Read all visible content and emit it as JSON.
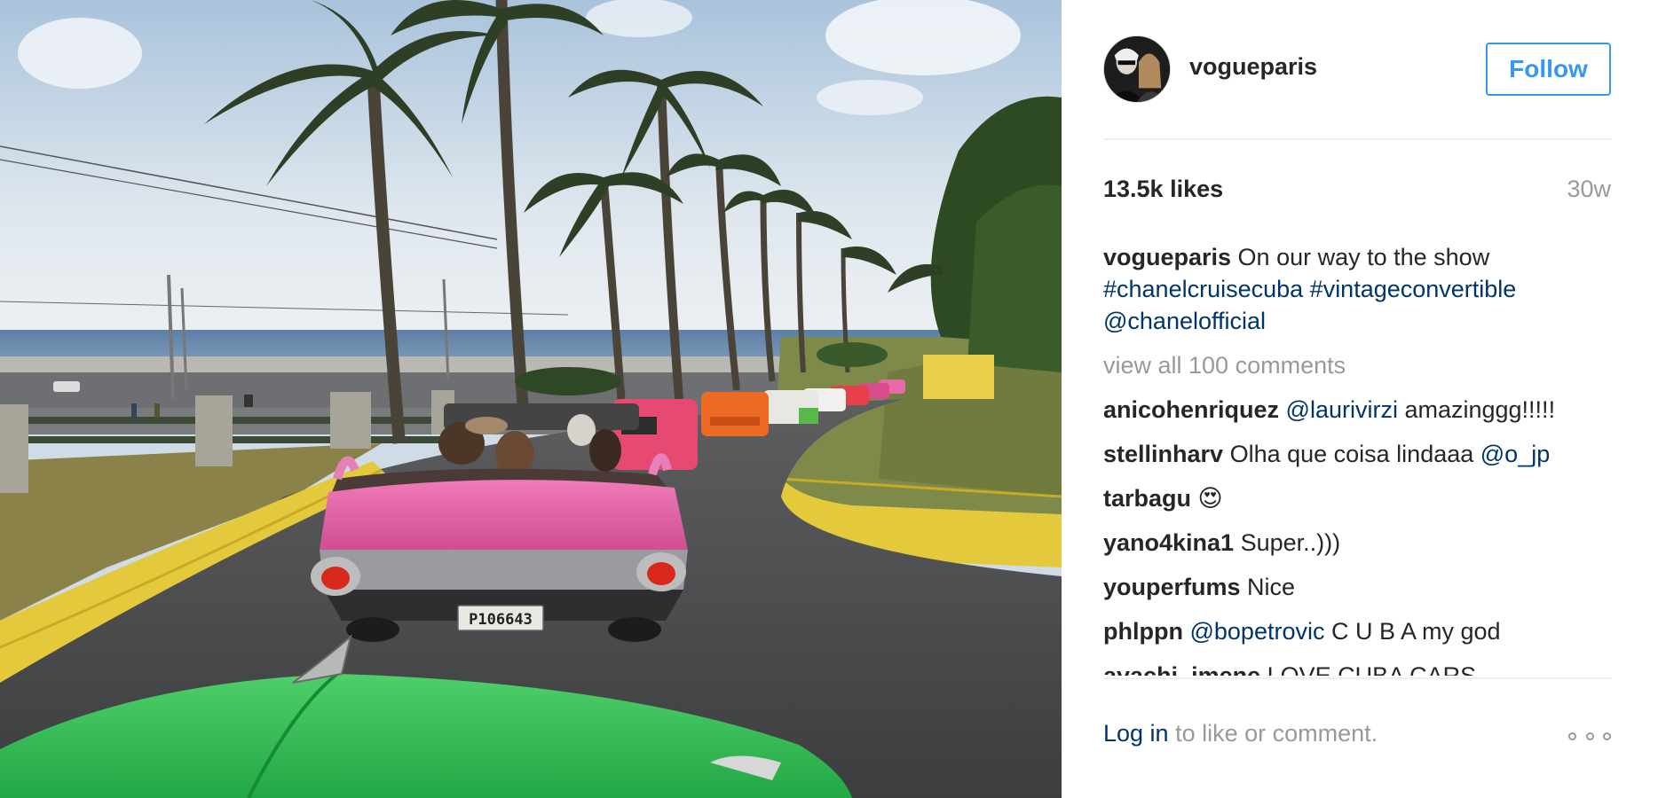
{
  "post": {
    "username": "vogueparis",
    "follow_label": "Follow",
    "likes": "13.5k likes",
    "age": "30w",
    "caption": {
      "username": "vogueparis",
      "text": " On our way to the show ",
      "tags": [
        "#chanelcruisecuba",
        "#vintageconvertible",
        "@chanelofficial"
      ]
    },
    "view_all": "view all 100 comments",
    "comments": [
      {
        "username": "anicohenriquez",
        "mention": "@laurivirzi",
        "text": " amazinggg!!!!!"
      },
      {
        "username": "stellinharv",
        "text": " Olha que coisa lindaaa ",
        "mention": "@o_jp"
      },
      {
        "username": "tarbagu",
        "emoji": "😍"
      },
      {
        "username": "yano4kina1",
        "text": " Super..)))"
      },
      {
        "username": "youperfums",
        "text": " Nice"
      },
      {
        "username": "phlppn",
        "mention": "@bopetrovic",
        "text": " C U B A my god"
      },
      {
        "username": "ayachi_imene",
        "text": " LOVE CUBA CARS"
      }
    ],
    "login_link": "Log in",
    "login_suffix": " to like or comment.",
    "license_plate": "P106643"
  },
  "icons": {
    "more": "more-options-icon",
    "avatar": "avatar"
  },
  "colors": {
    "link": "#003569",
    "follow": "#3897f0",
    "muted": "#999999",
    "text": "#262626"
  }
}
